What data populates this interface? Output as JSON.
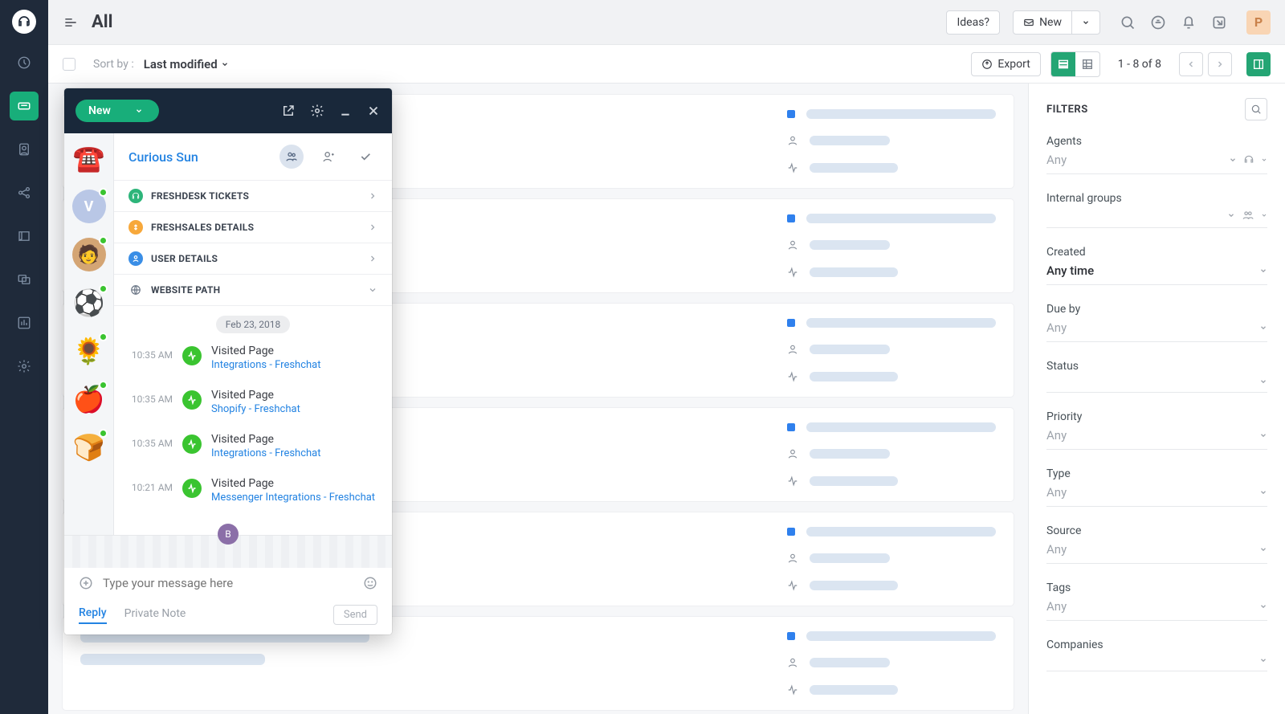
{
  "header": {
    "title": "All",
    "ideas": "Ideas?",
    "new": "New",
    "avatar_initial": "P"
  },
  "toolbar": {
    "sortby_label": "Sort by :",
    "sortby_value": "Last modified",
    "export": "Export",
    "pager": "1 - 8 of 8"
  },
  "filters": {
    "title": "FILTERS",
    "groups": [
      {
        "label": "Agents",
        "value": "Any",
        "icons": "headset"
      },
      {
        "label": "Internal groups",
        "value": "",
        "icons": "people"
      },
      {
        "label": "Created",
        "value": "Any time",
        "strong": true
      },
      {
        "label": "Due by",
        "value": "Any"
      },
      {
        "label": "Status",
        "value": ""
      },
      {
        "label": "Priority",
        "value": "Any"
      },
      {
        "label": "Type",
        "value": "Any"
      },
      {
        "label": "Source",
        "value": "Any"
      },
      {
        "label": "Tags",
        "value": "Any"
      },
      {
        "label": "Companies",
        "value": ""
      }
    ]
  },
  "chat": {
    "status": "New",
    "title": "Curious Sun",
    "accordion": [
      {
        "label": "FRESHDESK TICKETS",
        "icon": "green"
      },
      {
        "label": "FRESHSALES DETAILS",
        "icon": "orange"
      },
      {
        "label": "USER DETAILS",
        "icon": "blue"
      },
      {
        "label": "WEBSITE PATH",
        "icon": "globe",
        "open": true
      }
    ],
    "date": "Feb 23, 2018",
    "timeline": [
      {
        "time": "10:35 AM",
        "title": "Visited Page",
        "link": "Integrations - Freshchat"
      },
      {
        "time": "10:35 AM",
        "title": "Visited Page",
        "link": "Shopify - Freshchat"
      },
      {
        "time": "10:35 AM",
        "title": "Visited Page",
        "link": "Integrations - Freshchat"
      },
      {
        "time": "10:21 AM",
        "title": "Visited Page",
        "link": "Messenger Integrations - Freshchat"
      }
    ],
    "input_placeholder": "Type your message here",
    "tabs": {
      "reply": "Reply",
      "private": "Private Note"
    },
    "send": "Send",
    "bubble_initial": "B",
    "convos": [
      {
        "type": "phone",
        "emoji": "☎️"
      },
      {
        "type": "initial",
        "text": "V"
      },
      {
        "type": "photo",
        "emoji": "🧑"
      },
      {
        "type": "emoji",
        "emoji": "⚽"
      },
      {
        "type": "emoji",
        "emoji": "🌻"
      },
      {
        "type": "emoji",
        "emoji": "🍎"
      },
      {
        "type": "emoji",
        "emoji": "🍞"
      }
    ]
  }
}
